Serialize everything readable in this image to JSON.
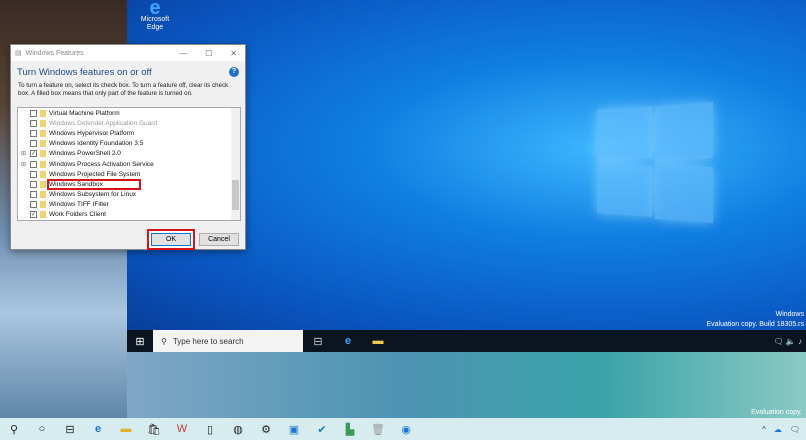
{
  "desktop": {
    "edge_icon_label": "Microsoft Edge",
    "watermark_line1": "Windows",
    "watermark_line2": "Evaluation copy. Build 18305.rs",
    "outer_watermark": "Evaluation copy."
  },
  "dialog": {
    "title": "Windows Features",
    "heading": "Turn Windows features on or off",
    "help": "?",
    "description": "To turn a feature on, select its check box. To turn a feature off, clear its check box. A filled box means that only part of the feature is turned on.",
    "features": [
      {
        "label": "Virtual Machine Platform",
        "checked": false,
        "expandable": false
      },
      {
        "label": "Windows Defender Application Guard",
        "checked": false,
        "expandable": false,
        "disabled": true
      },
      {
        "label": "Windows Hypervisor Platform",
        "checked": false,
        "expandable": false
      },
      {
        "label": "Windows Identity Foundation 3.5",
        "checked": false,
        "expandable": false
      },
      {
        "label": "Windows PowerShell 2.0",
        "checked": true,
        "expandable": true
      },
      {
        "label": "Windows Process Activation Service",
        "checked": false,
        "expandable": true
      },
      {
        "label": "Windows Projected File System",
        "checked": false,
        "expandable": false
      },
      {
        "label": "Windows Sandbox",
        "checked": false,
        "expandable": false,
        "highlighted": true
      },
      {
        "label": "Windows Subsystem for Linux",
        "checked": false,
        "expandable": false
      },
      {
        "label": "Windows TIFF IFilter",
        "checked": false,
        "expandable": false
      },
      {
        "label": "Work Folders Client",
        "checked": true,
        "expandable": false
      }
    ],
    "ok": "OK",
    "cancel": "Cancel"
  },
  "vm_taskbar": {
    "search_placeholder": "Type here to search"
  },
  "colors": {
    "highlight": "#d8121b",
    "accent": "#0078d7"
  }
}
